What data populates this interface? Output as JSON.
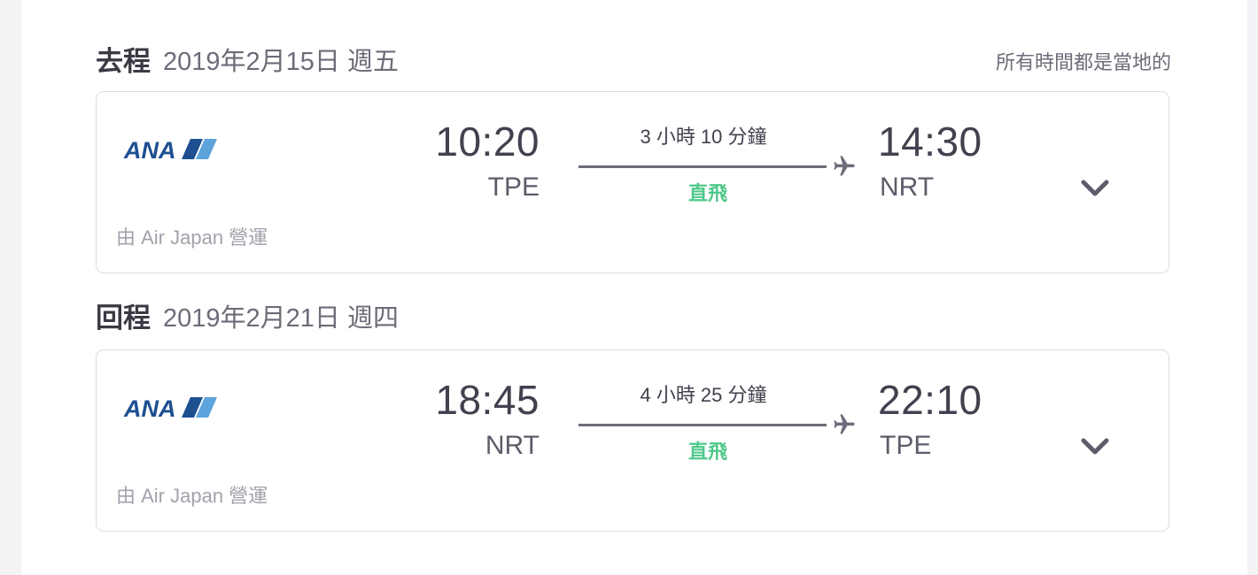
{
  "itinerary": {
    "local_time_note": "所有時間都是當地的",
    "legs": [
      {
        "label": "去程",
        "date": "2019年2月15日 週五",
        "airline_logo_text": "ANA",
        "operated_by": "由 Air Japan 營運",
        "depart_time": "10:20",
        "depart_code": "TPE",
        "duration": "3 小時 10 分鐘",
        "stops": "直飛",
        "arrive_time": "14:30",
        "arrive_code": "NRT"
      },
      {
        "label": "回程",
        "date": "2019年2月21日 週四",
        "airline_logo_text": "ANA",
        "operated_by": "由 Air Japan 營運",
        "depart_time": "18:45",
        "depart_code": "NRT",
        "duration": "4 小時 25 分鐘",
        "stops": "直飛",
        "arrive_time": "22:10",
        "arrive_code": "TPE"
      }
    ]
  },
  "colors": {
    "nonstop_green": "#4ec98a",
    "ana_blue": "#1d4f91",
    "ana_light_blue": "#5da3dc"
  },
  "icons": {
    "plane": "plane-icon",
    "expand": "chevron-down-icon"
  }
}
